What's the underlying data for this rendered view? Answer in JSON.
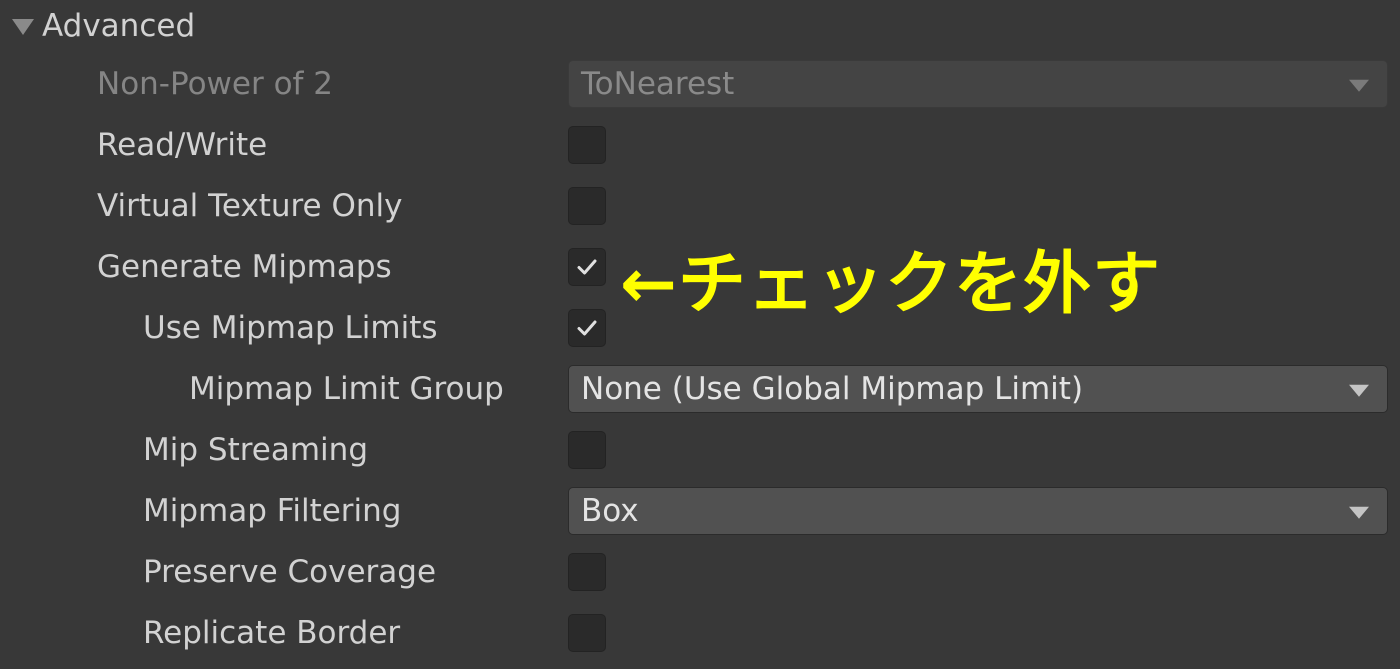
{
  "section": {
    "title": "Advanced",
    "arrow_icon": "foldout-expanded-icon"
  },
  "rows": [
    {
      "label": "Non-Power of 2",
      "control": "dropdown",
      "value": "ToNearest",
      "disabled": true
    },
    {
      "label": "Read/Write",
      "control": "checkbox",
      "checked": false
    },
    {
      "label": "Virtual Texture Only",
      "control": "checkbox",
      "checked": false
    },
    {
      "label": "Generate Mipmaps",
      "control": "checkbox",
      "checked": true
    },
    {
      "label": "Use Mipmap Limits",
      "control": "checkbox",
      "checked": true
    },
    {
      "label": "Mipmap Limit Group",
      "control": "dropdown",
      "value": "None (Use Global Mipmap Limit)"
    },
    {
      "label": "Mip Streaming",
      "control": "checkbox",
      "checked": false
    },
    {
      "label": "Mipmap Filtering",
      "control": "dropdown",
      "value": "Box"
    },
    {
      "label": "Preserve Coverage",
      "control": "checkbox",
      "checked": false
    },
    {
      "label": "Replicate Border",
      "control": "checkbox",
      "checked": false
    }
  ],
  "annotation": {
    "text": "←チェックを外す",
    "color": "#ffff00"
  },
  "colors": {
    "background": "#383838",
    "label": "#d2d2d2",
    "disabled_label": "#858585",
    "field": "#515151",
    "checkbox": "#2a2a2a"
  }
}
